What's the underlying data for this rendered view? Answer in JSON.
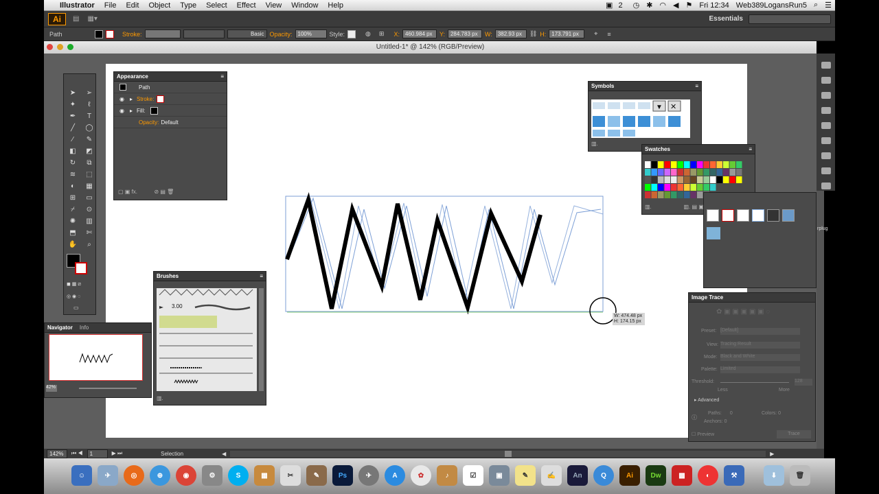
{
  "menubar": {
    "app_name": "Illustrator",
    "items": [
      "File",
      "Edit",
      "Object",
      "Type",
      "Select",
      "Effect",
      "View",
      "Window",
      "Help"
    ],
    "badge_count": "2",
    "clock": "Fri 12:34",
    "user": "Web389LogansRun5"
  },
  "appbar": {
    "logo": "Ai",
    "workspace": "Essentials"
  },
  "controlbar": {
    "selection_label": "Path",
    "stroke_label": "Stroke:",
    "brush_label": "Basic",
    "opacity_label": "Opacity:",
    "opacity_value": "100%",
    "style_label": "Style:",
    "x_label": "X:",
    "x_value": "460.984 px",
    "y_label": "Y:",
    "y_value": "284.783 px",
    "w_label": "W:",
    "w_value": "382.93 px",
    "h_label": "H:",
    "h_value": "173.791 px"
  },
  "document": {
    "title": "Untitled-1* @ 142% (RGB/Preview)"
  },
  "appearance": {
    "title": "Appearance",
    "path_label": "Path",
    "stroke_label": "Stroke:",
    "fill_label": "Fill:",
    "opacity_label": "Opacity:",
    "opacity_value": "Default"
  },
  "symbols": {
    "title": "Symbols"
  },
  "swatches": {
    "title": "Swatches"
  },
  "brushes": {
    "title": "Brushes",
    "size_label": "3.00"
  },
  "navigator": {
    "tab1": "Navigator",
    "tab2": "Info",
    "zoom": "42%"
  },
  "image_trace": {
    "title": "Image Trace",
    "preset_label": "Preset:",
    "preset_value": "[Default]",
    "view_label": "View:",
    "view_value": "Tracing Result",
    "mode_label": "Mode:",
    "mode_value": "Black and White",
    "palette_label": "Palette:",
    "palette_value": "Limited",
    "threshold_label": "Threshold:",
    "threshold_value": "128",
    "less_label": "Less",
    "more_label": "More",
    "advanced_label": "Advanced",
    "paths_label": "Paths:",
    "paths_value": "0",
    "colors_label": "Colors:",
    "colors_value": "0",
    "anchors_label": "Anchors:",
    "anchors_value": "0",
    "preview_label": "Preview",
    "trace_label": "Trace"
  },
  "measure_tooltip": {
    "w": "W: 474.48 px",
    "h": "H: 174.15 px"
  },
  "side_text": "rplug",
  "statusbar": {
    "zoom": "142%",
    "page": "1",
    "tool": "Selection"
  },
  "dock": [
    "Ps",
    "An",
    "Ai",
    "Dw"
  ]
}
